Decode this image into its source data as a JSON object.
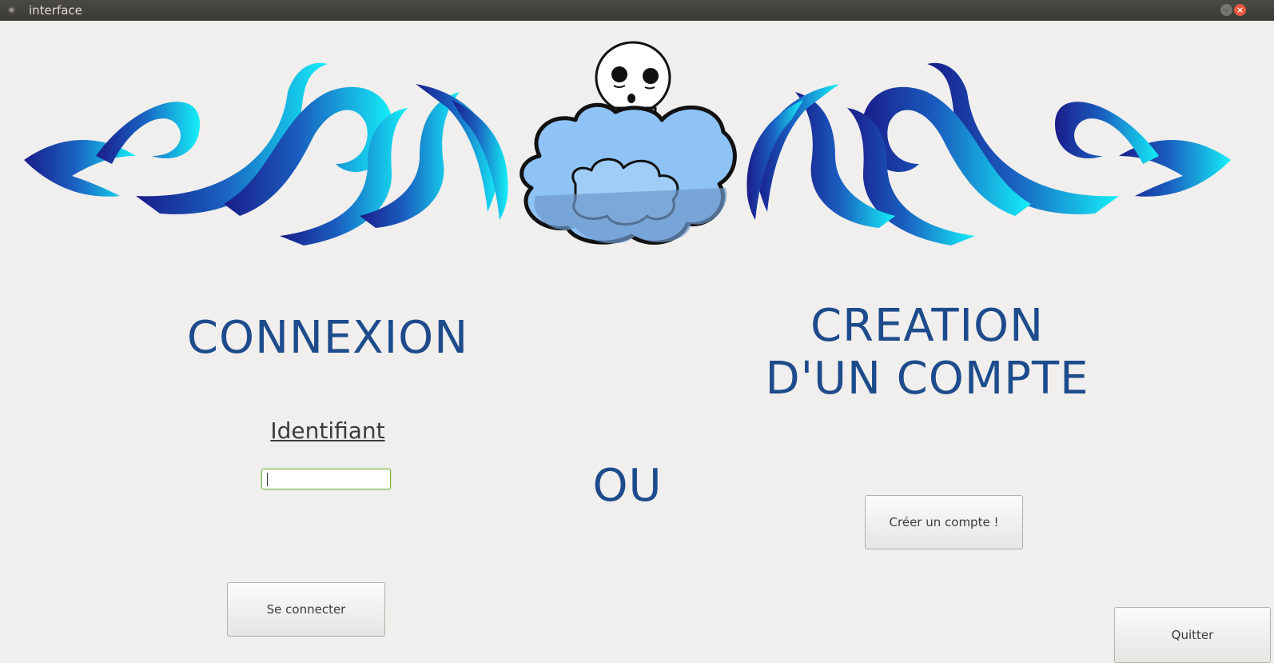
{
  "window": {
    "title": "interface",
    "minimize_glyph": "–",
    "close_glyph": "×"
  },
  "login": {
    "heading": "CONNEXION",
    "id_label": "Identifiant",
    "id_value": "",
    "submit_label": "Se connecter"
  },
  "separator": "OU",
  "signup": {
    "heading_line1": "CREATION",
    "heading_line2": "D'UN COMPTE",
    "button_label": "Créer un compte !"
  },
  "quit_label": "Quitter",
  "colors": {
    "heading": "#1e4b8c",
    "ornament_dark": "#1a1c8a",
    "ornament_light": "#14e6f5",
    "cloud": "#8fc3f5",
    "background": "#f0efed"
  },
  "icons": [
    "app-icon",
    "minimize-icon",
    "close-icon",
    "tribal-ornament-left",
    "tribal-ornament-right",
    "cloud-spirit-mascot"
  ]
}
